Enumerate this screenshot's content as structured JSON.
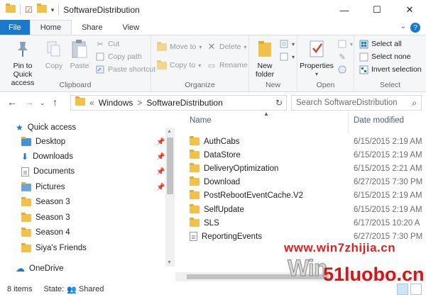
{
  "window": {
    "title": "SoftwareDistribution",
    "controls": [
      "—",
      "☐",
      "✕"
    ]
  },
  "ribbon_tabs": [
    "File",
    "Home",
    "Share",
    "View"
  ],
  "ribbon": {
    "clipboard": {
      "label": "Clipboard",
      "pin_label": "Pin to Quick access",
      "copy": "Copy",
      "paste": "Paste",
      "cut": "Cut",
      "copy_path": "Copy path",
      "paste_shortcut": "Paste shortcut"
    },
    "organize": {
      "label": "Organize",
      "move_to": "Move to",
      "copy_to": "Copy to",
      "delete": "Delete",
      "rename": "Rename"
    },
    "new": {
      "label": "New",
      "new_folder": "New folder"
    },
    "open": {
      "label": "Open",
      "properties": "Properties"
    },
    "select": {
      "label": "Select",
      "select_all": "Select all",
      "select_none": "Select none",
      "invert": "Invert selection"
    }
  },
  "address": {
    "prefix": "«",
    "path1": "Windows",
    "sep": ">",
    "path2": "SoftwareDistribution"
  },
  "search": {
    "placeholder": "Search SoftwareDistribution"
  },
  "nav": {
    "quick_access": "Quick access",
    "items": [
      {
        "label": "Desktop",
        "pinned": true
      },
      {
        "label": "Downloads",
        "pinned": true
      },
      {
        "label": "Documents",
        "pinned": true
      },
      {
        "label": "Pictures",
        "pinned": true
      },
      {
        "label": "Season 3",
        "pinned": false
      },
      {
        "label": "Season 3",
        "pinned": false
      },
      {
        "label": "Season 4",
        "pinned": false
      },
      {
        "label": "Siya's Friends",
        "pinned": false
      }
    ],
    "onedrive": "OneDrive"
  },
  "columns": {
    "name": "Name",
    "date": "Date modified"
  },
  "files": [
    {
      "name": "AuthCabs",
      "date": "6/15/2015 2:19 AM",
      "type": "folder"
    },
    {
      "name": "DataStore",
      "date": "6/15/2015 2:19 AM",
      "type": "folder"
    },
    {
      "name": "DeliveryOptimization",
      "date": "6/15/2015 2:21 AM",
      "type": "folder"
    },
    {
      "name": "Download",
      "date": "6/27/2015 7:30 PM",
      "type": "folder"
    },
    {
      "name": "PostRebootEventCache.V2",
      "date": "6/15/2015 2:19 AM",
      "type": "folder"
    },
    {
      "name": "SelfUpdate",
      "date": "6/15/2015 2:19 AM",
      "type": "folder"
    },
    {
      "name": "SLS",
      "date": "6/17/2015 10:20 A",
      "type": "folder"
    },
    {
      "name": "ReportingEvents",
      "date": "6/27/2015 7:30 PM",
      "type": "file"
    }
  ],
  "status": {
    "items": "8 items",
    "state_label": "State:",
    "state_value": "Shared"
  },
  "watermark": {
    "line1": "www.win7zhijia.cn",
    "line2": "Win",
    "line3": "51luobo.cn"
  },
  "colors": {
    "accent": "#1979ca",
    "folder": "#f0c14b"
  }
}
